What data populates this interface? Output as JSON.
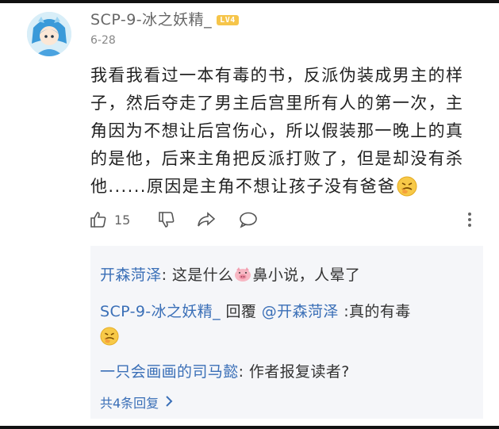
{
  "post": {
    "username": "SCP-9-冰之妖精_",
    "level_badge": "LV4",
    "date": "6-28",
    "content_lines": [
      "我看我看过一本有毒的书，反派伪装成男主的样",
      "子，然后夺走了男主后宫里所有人的第一次，主",
      "角因为不想让后宫伤心，所以假装那一晚上的真",
      "的是他，后来主角把反派打败了，但是却没有杀",
      "他......原因是主角不想让孩子没有爸爸"
    ]
  },
  "actions": {
    "like_icon": "thumb-up-icon",
    "like_count": "15",
    "dislike_icon": "thumb-down-icon",
    "share_icon": "share-icon",
    "comment_icon": "comment-icon",
    "more_icon": "more-vertical-icon"
  },
  "replies": {
    "items": [
      {
        "name": "开森菏泽",
        "sep": ":",
        "text_a": " 这是什么",
        "text_b": "鼻小说，人晕了"
      },
      {
        "name": "SCP-9-冰之妖精_",
        "reply_word": " 回覆 ",
        "mention": "@开森菏泽",
        "text": " :真的有毒"
      },
      {
        "name": "一只会画画的司马懿",
        "sep": ":",
        "text": " 作者报复读者?"
      }
    ],
    "more_label": "共4条回复",
    "more_icon": "chevron-right-icon"
  },
  "colors": {
    "link_blue": "#3a6fb7",
    "badge_yellow": "#f6c54a",
    "reply_bg": "#f5f6f9"
  }
}
